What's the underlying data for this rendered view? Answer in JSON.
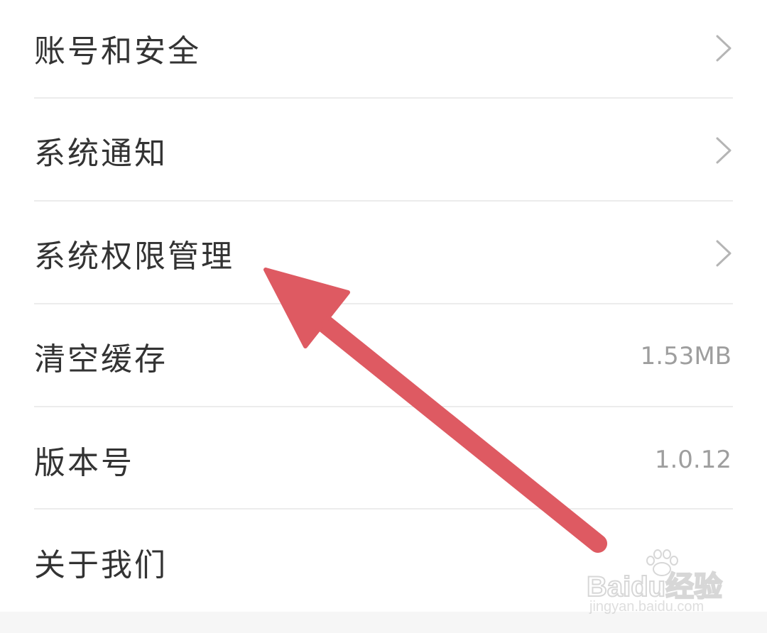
{
  "settings": {
    "items": [
      {
        "label": "账号和安全",
        "value": "",
        "chevron": true
      },
      {
        "label": "系统通知",
        "value": "",
        "chevron": true
      },
      {
        "label": "系统权限管理",
        "value": "",
        "chevron": true
      },
      {
        "label": "清空缓存",
        "value": "1.53MB",
        "chevron": false
      },
      {
        "label": "版本号",
        "value": "1.0.12",
        "chevron": false
      },
      {
        "label": "关于我们",
        "value": "",
        "chevron": false
      }
    ]
  },
  "annotation": {
    "arrow_color": "#de5a62",
    "points_to": "系统权限管理"
  },
  "watermark": {
    "brand": "Baidu经验",
    "site": "jingyan.baidu.com"
  },
  "icons": {
    "chevron": "chevron-right-icon",
    "paw": "baidu-paw-icon"
  },
  "colors": {
    "label": "#333333",
    "value": "#9e9e9e",
    "divider": "#ececec",
    "background": "#ffffff"
  }
}
